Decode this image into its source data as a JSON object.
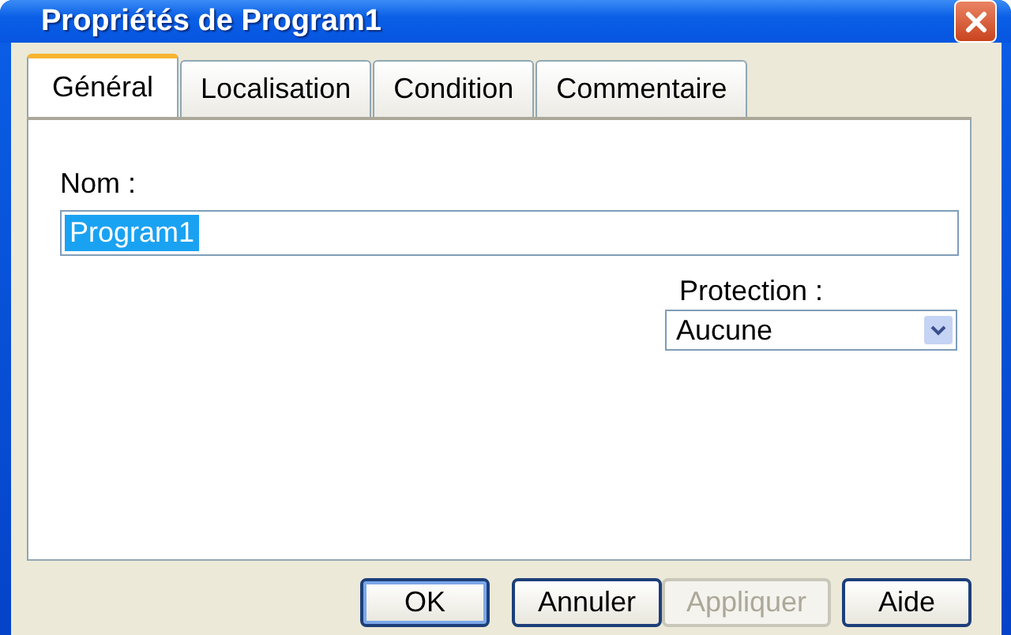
{
  "window": {
    "title": "Propriétés de Program1"
  },
  "tabs": [
    {
      "label": "Général",
      "selected": true
    },
    {
      "label": "Localisation",
      "selected": false
    },
    {
      "label": "Condition",
      "selected": false
    },
    {
      "label": "Commentaire",
      "selected": false
    }
  ],
  "name_field": {
    "label": "Nom :",
    "value": "Program1",
    "text_selected": true
  },
  "protection": {
    "label": "Protection :",
    "value": "Aucune"
  },
  "buttons": [
    {
      "label": "OK",
      "default": true,
      "disabled": false
    },
    {
      "label": "Annuler",
      "default": false,
      "disabled": false
    },
    {
      "label": "Appliquer",
      "default": false,
      "disabled": true
    },
    {
      "label": "Aide",
      "default": false,
      "disabled": false
    }
  ]
}
